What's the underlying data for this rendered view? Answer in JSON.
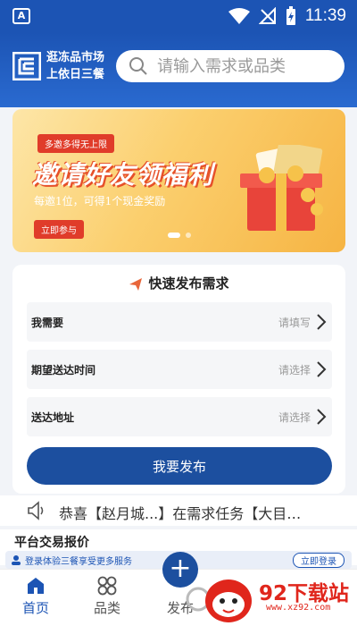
{
  "status_bar": {
    "time": "11:39",
    "left_badge": "A"
  },
  "header": {
    "slogan_line1": "逛冻品市场",
    "slogan_line2": "上依日三餐",
    "search_placeholder": "请输入需求或品类"
  },
  "banner": {
    "tag": "多邀多得无上限",
    "title": "邀请好友领福利",
    "subtitle": "每邀1位，可得1个现金奖励",
    "button": "立即参与",
    "slides": 2,
    "active_slide": 1
  },
  "quick_post": {
    "title": "快速发布需求",
    "fields": [
      {
        "label": "我需要",
        "hint": "请填写"
      },
      {
        "label": "期望送达时间",
        "hint": "请选择"
      },
      {
        "label": "送达地址",
        "hint": "请选择"
      }
    ],
    "submit_label": "我要发布"
  },
  "marquee": {
    "text": "恭喜【赵月城...】在需求任务【大目…"
  },
  "section": {
    "title": "平台交易报价",
    "login_hint": "登录体验三餐享受更多服务",
    "login_button": "立即登录"
  },
  "tabbar": {
    "items": [
      {
        "label": "首页",
        "icon": "home-icon",
        "active": true
      },
      {
        "label": "品类",
        "icon": "category-icon",
        "active": false
      },
      {
        "label": "发布",
        "icon": "plus-icon",
        "active": false
      }
    ]
  },
  "watermark": {
    "text": "92下载站",
    "url": "www.xz92.com"
  },
  "colors": {
    "primary": "#1c54b4",
    "button": "#1c4f9f",
    "banner_red": "#e03c2a",
    "watermark": "#e0261c"
  }
}
